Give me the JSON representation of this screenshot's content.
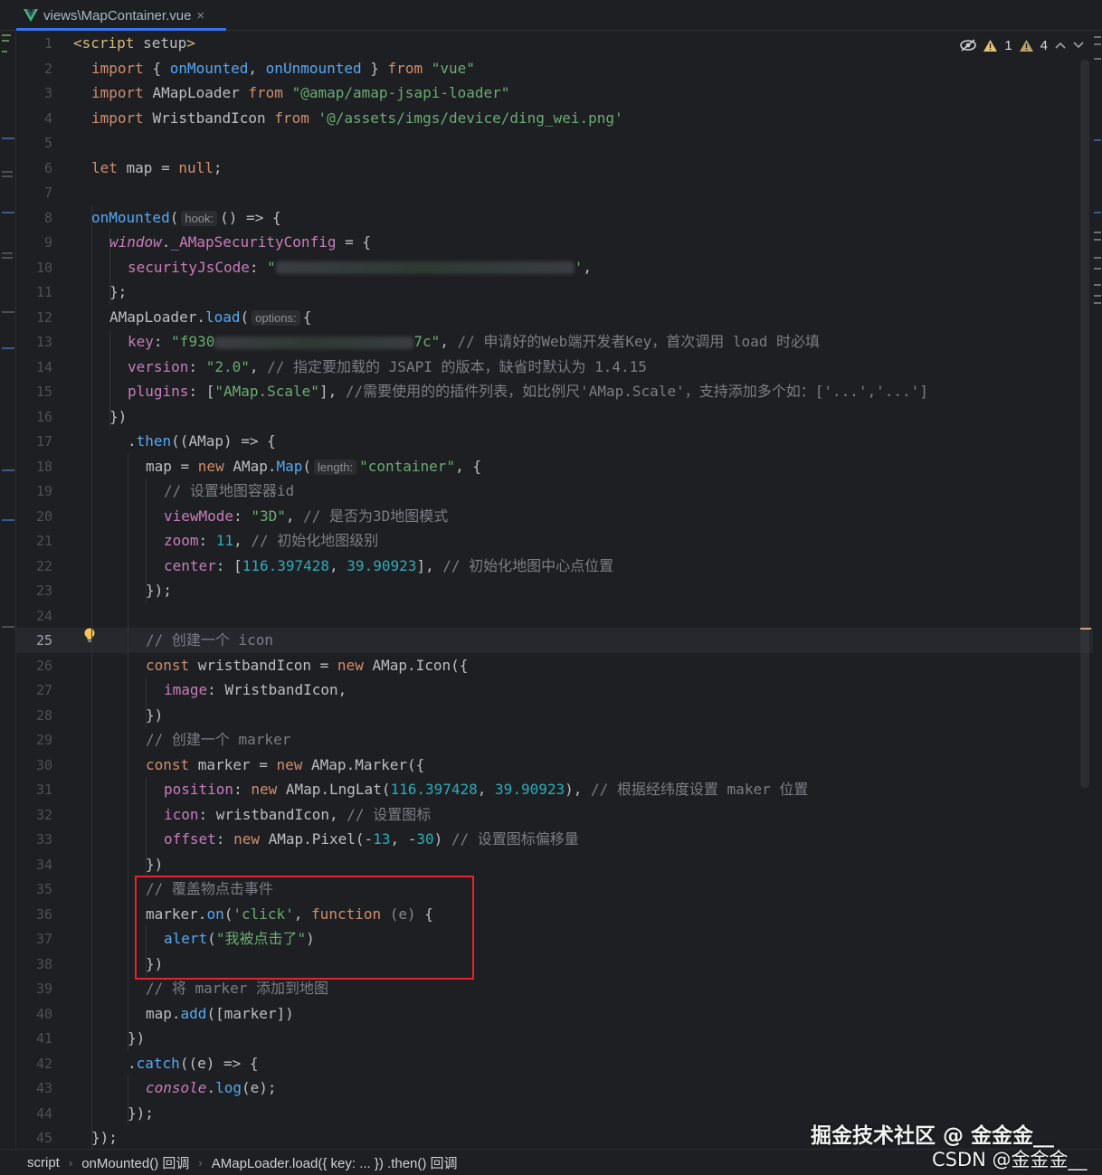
{
  "tab": {
    "title": "views\\MapContainer.vue",
    "close": "×"
  },
  "inspections": {
    "warnings_1": "1",
    "warnings_2": "4",
    "up": "^",
    "down": "v"
  },
  "gutter": {
    "active_line": 25
  },
  "code": [
    {
      "n": "1",
      "tokens": [
        [
          "tag",
          "<script "
        ],
        [
          "plain",
          "setup"
        ],
        [
          "tag",
          ">"
        ]
      ]
    },
    {
      "n": "2",
      "tokens": [
        [
          "kw",
          "import "
        ],
        [
          "plain",
          "{ "
        ],
        [
          "fn",
          "onMounted"
        ],
        [
          "plain",
          ", "
        ],
        [
          "fn",
          "onUnmounted"
        ],
        [
          "plain",
          " } "
        ],
        [
          "kw",
          "from "
        ],
        [
          "str",
          "\"vue\""
        ]
      ]
    },
    {
      "n": "3",
      "tokens": [
        [
          "kw",
          "import "
        ],
        [
          "plain",
          "AMapLoader "
        ],
        [
          "kw",
          "from "
        ],
        [
          "str",
          "\"@amap/amap-jsapi-loader\""
        ]
      ]
    },
    {
      "n": "4",
      "tokens": [
        [
          "kw",
          "import "
        ],
        [
          "plain",
          "WristbandIcon "
        ],
        [
          "kw",
          "from "
        ],
        [
          "str",
          "'@/assets/imgs/device/ding_wei.png'"
        ]
      ]
    },
    {
      "n": "5",
      "tokens": []
    },
    {
      "n": "6",
      "tokens": [
        [
          "kw",
          "let "
        ],
        [
          "plain",
          "map = "
        ],
        [
          "kw",
          "null"
        ],
        [
          "plain",
          ";"
        ]
      ]
    },
    {
      "n": "7",
      "tokens": []
    },
    {
      "n": "8",
      "tokens": [
        [
          "fn",
          "onMounted"
        ],
        [
          "plain",
          "("
        ],
        [
          "hint",
          "hook:"
        ],
        [
          "plain",
          "() => {"
        ]
      ]
    },
    {
      "n": "9",
      "tokens": [
        [
          "ital",
          "window"
        ],
        [
          "plain",
          "."
        ],
        [
          "prop",
          "_AMapSecurityConfig"
        ],
        [
          "plain",
          " = {"
        ]
      ]
    },
    {
      "n": "10",
      "tokens": [
        [
          "prop",
          "securityJsCode"
        ],
        [
          "plain",
          ": "
        ],
        [
          "str",
          "\""
        ],
        [
          "blur",
          "330"
        ],
        [
          "str",
          "'"
        ],
        [
          "plain",
          ","
        ]
      ]
    },
    {
      "n": "11",
      "tokens": [
        [
          "plain",
          "};"
        ]
      ]
    },
    {
      "n": "12",
      "tokens": [
        [
          "plain",
          "AMapLoader."
        ],
        [
          "fn",
          "load"
        ],
        [
          "plain",
          "("
        ],
        [
          "hint",
          "options:"
        ],
        [
          "plain",
          "{"
        ]
      ]
    },
    {
      "n": "13",
      "tokens": [
        [
          "prop",
          "key"
        ],
        [
          "plain",
          ": "
        ],
        [
          "str",
          "\"f930"
        ],
        [
          "blur",
          "220"
        ],
        [
          "str",
          "7c\""
        ],
        [
          "plain",
          ", "
        ],
        [
          "com",
          "// 申请好的Web端开发者Key，首次调用 load 时必填"
        ]
      ]
    },
    {
      "n": "14",
      "tokens": [
        [
          "prop",
          "version"
        ],
        [
          "plain",
          ": "
        ],
        [
          "str",
          "\"2.0\""
        ],
        [
          "plain",
          ", "
        ],
        [
          "com",
          "// 指定要加载的 JSAPI 的版本，缺省时默认为 1.4.15"
        ]
      ]
    },
    {
      "n": "15",
      "tokens": [
        [
          "prop",
          "plugins"
        ],
        [
          "plain",
          ": ["
        ],
        [
          "str",
          "\"AMap.Scale\""
        ],
        [
          "plain",
          "], "
        ],
        [
          "com",
          "//需要使用的的插件列表，如比例尺'AMap.Scale'，支持添加多个如：['...','...']"
        ]
      ]
    },
    {
      "n": "16",
      "tokens": [
        [
          "plain",
          "})"
        ]
      ]
    },
    {
      "n": "17",
      "tokens": [
        [
          "plain",
          "."
        ],
        [
          "fn",
          "then"
        ],
        [
          "plain",
          "((AMap) => {"
        ]
      ]
    },
    {
      "n": "18",
      "tokens": [
        [
          "plain",
          "map = "
        ],
        [
          "kw",
          "new "
        ],
        [
          "plain",
          "AMap."
        ],
        [
          "fn",
          "Map"
        ],
        [
          "plain",
          "("
        ],
        [
          "hint",
          "length:"
        ],
        [
          "str",
          "\"container\""
        ],
        [
          "plain",
          ", {"
        ]
      ]
    },
    {
      "n": "19",
      "tokens": [
        [
          "com",
          "// 设置地图容器id"
        ]
      ]
    },
    {
      "n": "20",
      "tokens": [
        [
          "prop",
          "viewMode"
        ],
        [
          "plain",
          ": "
        ],
        [
          "str",
          "\"3D\""
        ],
        [
          "plain",
          ", "
        ],
        [
          "com",
          "// 是否为3D地图模式"
        ]
      ]
    },
    {
      "n": "21",
      "tokens": [
        [
          "prop",
          "zoom"
        ],
        [
          "plain",
          ": "
        ],
        [
          "num",
          "11"
        ],
        [
          "plain",
          ", "
        ],
        [
          "com",
          "// 初始化地图级别"
        ]
      ]
    },
    {
      "n": "22",
      "tokens": [
        [
          "prop",
          "center"
        ],
        [
          "plain",
          ": ["
        ],
        [
          "num",
          "116.397428"
        ],
        [
          "plain",
          ", "
        ],
        [
          "num",
          "39.90923"
        ],
        [
          "plain",
          "], "
        ],
        [
          "com",
          "// 初始化地图中心点位置"
        ]
      ]
    },
    {
      "n": "23",
      "tokens": [
        [
          "plain",
          "});"
        ]
      ]
    },
    {
      "n": "24",
      "tokens": []
    },
    {
      "n": "25",
      "tokens": [
        [
          "com",
          "// 创建一个 icon"
        ]
      ]
    },
    {
      "n": "26",
      "tokens": [
        [
          "kw",
          "const "
        ],
        [
          "plain",
          "wristbandIcon = "
        ],
        [
          "kw",
          "new "
        ],
        [
          "plain",
          "AMap.Icon({"
        ]
      ]
    },
    {
      "n": "27",
      "tokens": [
        [
          "prop",
          "image"
        ],
        [
          "plain",
          ": WristbandIcon,"
        ]
      ]
    },
    {
      "n": "28",
      "tokens": [
        [
          "plain",
          "})"
        ]
      ]
    },
    {
      "n": "29",
      "tokens": [
        [
          "com",
          "// 创建一个 marker"
        ]
      ]
    },
    {
      "n": "30",
      "tokens": [
        [
          "kw",
          "const "
        ],
        [
          "plain",
          "marker = "
        ],
        [
          "kw",
          "new "
        ],
        [
          "plain",
          "AMap.Marker({"
        ]
      ]
    },
    {
      "n": "31",
      "tokens": [
        [
          "prop",
          "position"
        ],
        [
          "plain",
          ": "
        ],
        [
          "kw",
          "new "
        ],
        [
          "plain",
          "AMap.LngLat("
        ],
        [
          "num",
          "116.397428"
        ],
        [
          "plain",
          ", "
        ],
        [
          "num",
          "39.90923"
        ],
        [
          "plain",
          "), "
        ],
        [
          "com",
          "// 根据经纬度设置 maker 位置"
        ]
      ]
    },
    {
      "n": "32",
      "tokens": [
        [
          "prop",
          "icon"
        ],
        [
          "plain",
          ": wristbandIcon, "
        ],
        [
          "com",
          "// 设置图标"
        ]
      ]
    },
    {
      "n": "33",
      "tokens": [
        [
          "prop",
          "offset"
        ],
        [
          "plain",
          ": "
        ],
        [
          "kw",
          "new "
        ],
        [
          "plain",
          "AMap.Pixel(-"
        ],
        [
          "num",
          "13"
        ],
        [
          "plain",
          ", -"
        ],
        [
          "num",
          "30"
        ],
        [
          "plain",
          ") "
        ],
        [
          "com",
          "// 设置图标偏移量"
        ]
      ]
    },
    {
      "n": "34",
      "tokens": [
        [
          "plain",
          "})"
        ]
      ]
    },
    {
      "n": "35",
      "tokens": [
        [
          "com",
          "// 覆盖物点击事件"
        ]
      ]
    },
    {
      "n": "36",
      "tokens": [
        [
          "plain",
          "marker."
        ],
        [
          "fn",
          "on"
        ],
        [
          "plain",
          "("
        ],
        [
          "str",
          "'click'"
        ],
        [
          "plain",
          ", "
        ],
        [
          "kw",
          "function "
        ],
        [
          "param",
          "(e) "
        ],
        [
          "plain",
          "{"
        ]
      ]
    },
    {
      "n": "37",
      "tokens": [
        [
          "fn",
          "alert"
        ],
        [
          "plain",
          "("
        ],
        [
          "str",
          "\"我被点击了\""
        ],
        [
          "plain",
          ")"
        ]
      ]
    },
    {
      "n": "38",
      "tokens": [
        [
          "plain",
          "})"
        ]
      ]
    },
    {
      "n": "39",
      "tokens": [
        [
          "com",
          "// 将 marker 添加到地图"
        ]
      ]
    },
    {
      "n": "40",
      "tokens": [
        [
          "plain",
          "map."
        ],
        [
          "fn",
          "add"
        ],
        [
          "plain",
          "([marker])"
        ]
      ]
    },
    {
      "n": "41",
      "tokens": [
        [
          "plain",
          "})"
        ]
      ]
    },
    {
      "n": "42",
      "tokens": [
        [
          "plain",
          "."
        ],
        [
          "fn",
          "catch"
        ],
        [
          "plain",
          "((e) => {"
        ]
      ]
    },
    {
      "n": "43",
      "tokens": [
        [
          "ital",
          "console"
        ],
        [
          "plain",
          "."
        ],
        [
          "fn",
          "log"
        ],
        [
          "plain",
          "(e);"
        ]
      ]
    },
    {
      "n": "44",
      "tokens": [
        [
          "plain",
          "});"
        ]
      ]
    },
    {
      "n": "45",
      "tokens": [
        [
          "plain",
          "});"
        ]
      ]
    }
  ],
  "indents": [
    0,
    20,
    20,
    20,
    0,
    20,
    0,
    20,
    40,
    60,
    40,
    40,
    60,
    60,
    60,
    40,
    60,
    80,
    100,
    100,
    100,
    100,
    80,
    80,
    80,
    80,
    100,
    80,
    80,
    80,
    100,
    100,
    100,
    80,
    80,
    80,
    100,
    80,
    80,
    80,
    60,
    60,
    80,
    60,
    20
  ],
  "statusbar": {
    "crumbs": [
      "script",
      "onMounted() 回调",
      "AMapLoader.load({ key: ... }) .then() 回调"
    ]
  },
  "watermark": {
    "line1": "掘金技术社区 @ 金金金__",
    "line2": "CSDN @金金金__"
  },
  "colors": {
    "accent": "#3574f0",
    "highlight_box": "#e02430",
    "warning": "#e5c07b"
  }
}
